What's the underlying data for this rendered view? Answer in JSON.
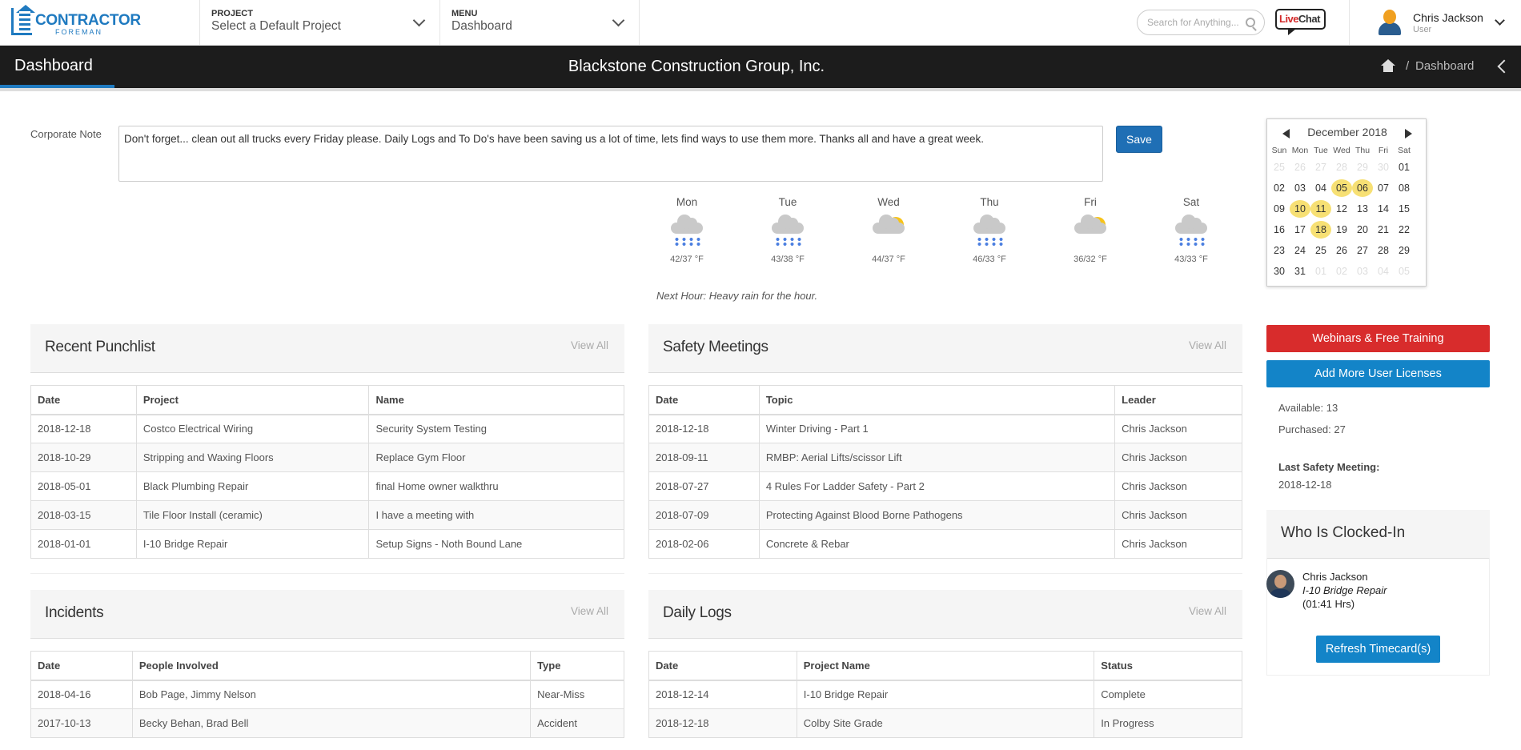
{
  "header": {
    "logo_main": "CONTRACTOR",
    "logo_sub": "FOREMAN",
    "project_label": "PROJECT",
    "project_value": "Select a Default Project",
    "menu_label": "MENU",
    "menu_value": "Dashboard",
    "search_placeholder": "Search for Anything...",
    "livechat_live": "Live",
    "livechat_chat": "Chat",
    "user_name": "Chris Jackson",
    "user_role": "User"
  },
  "titlebar": {
    "page_title": "Dashboard",
    "company": "Blackstone Construction Group, Inc.",
    "breadcrumb_sep": "/",
    "breadcrumb": "Dashboard"
  },
  "note": {
    "label": "Corporate Note",
    "text": "Don't forget... clean out all trucks every Friday please. Daily Logs and To Do's have been saving us a lot of time, lets find ways to use them more. Thanks all and have a great week.",
    "save_label": "Save"
  },
  "weather": {
    "days": [
      {
        "day": "Mon",
        "temp": "42/37 °F",
        "icon": "rain-cloud-icon"
      },
      {
        "day": "Tue",
        "temp": "43/38 °F",
        "icon": "rain-cloud-icon"
      },
      {
        "day": "Wed",
        "temp": "44/37 °F",
        "icon": "partly-sunny-icon"
      },
      {
        "day": "Thu",
        "temp": "46/33 °F",
        "icon": "rain-cloud-icon"
      },
      {
        "day": "Fri",
        "temp": "36/32 °F",
        "icon": "partly-sunny-icon"
      },
      {
        "day": "Sat",
        "temp": "43/33 °F",
        "icon": "rain-cloud-icon"
      }
    ],
    "next_hour": "Next Hour: Heavy rain for the hour."
  },
  "calendar": {
    "month": "December 2018",
    "dows": [
      "Sun",
      "Mon",
      "Tue",
      "Wed",
      "Thu",
      "Fri",
      "Sat"
    ],
    "weeks": [
      [
        "25",
        "26",
        "27",
        "28",
        "29",
        "30",
        "01"
      ],
      [
        "02",
        "03",
        "04",
        "05",
        "06",
        "07",
        "08"
      ],
      [
        "09",
        "10",
        "11",
        "12",
        "13",
        "14",
        "15"
      ],
      [
        "16",
        "17",
        "18",
        "19",
        "20",
        "21",
        "22"
      ],
      [
        "23",
        "24",
        "25",
        "26",
        "27",
        "28",
        "29"
      ],
      [
        "30",
        "31",
        "01",
        "02",
        "03",
        "04",
        "05"
      ]
    ],
    "highlighted": [
      "05",
      "06",
      "10",
      "11",
      "18"
    ],
    "highlight_color": "#f7e074"
  },
  "punchlist": {
    "title": "Recent Punchlist",
    "view_all": "View All",
    "columns": [
      "Date",
      "Project",
      "Name"
    ],
    "rows": [
      [
        "2018-12-18",
        "Costco Electrical Wiring",
        "Security System Testing"
      ],
      [
        "2018-10-29",
        "Stripping and Waxing Floors",
        "Replace Gym Floor"
      ],
      [
        "2018-05-01",
        "Black Plumbing Repair",
        "final Home owner walkthru"
      ],
      [
        "2018-03-15",
        "Tile Floor Install (ceramic)",
        "I have a meeting with"
      ],
      [
        "2018-01-01",
        "I-10 Bridge Repair",
        "Setup Signs - Noth Bound Lane"
      ]
    ]
  },
  "safety": {
    "title": "Safety Meetings",
    "view_all": "View All",
    "columns": [
      "Date",
      "Topic",
      "Leader"
    ],
    "rows": [
      [
        "2018-12-18",
        "Winter Driving - Part 1",
        "Chris Jackson"
      ],
      [
        "2018-09-11",
        "RMBP: Aerial Lifts/scissor Lift",
        "Chris Jackson"
      ],
      [
        "2018-07-27",
        "4 Rules For Ladder Safety - Part 2",
        "Chris Jackson"
      ],
      [
        "2018-07-09",
        "Protecting Against Blood Borne Pathogens",
        "Chris Jackson"
      ],
      [
        "2018-02-06",
        "Concrete & Rebar",
        "Chris Jackson"
      ]
    ]
  },
  "incidents": {
    "title": "Incidents",
    "view_all": "View All",
    "columns": [
      "Date",
      "People Involved",
      "Type"
    ],
    "rows": [
      [
        "2018-04-16",
        "Bob Page, Jimmy Nelson",
        "Near-Miss"
      ],
      [
        "2017-10-13",
        "Becky Behan, Brad Bell",
        "Accident"
      ]
    ]
  },
  "dailylogs": {
    "title": "Daily Logs",
    "view_all": "View All",
    "columns": [
      "Date",
      "Project Name",
      "Status"
    ],
    "rows": [
      [
        "2018-12-14",
        "I-10 Bridge Repair",
        "Complete"
      ],
      [
        "2018-12-18",
        "Colby Site Grade",
        "In Progress"
      ]
    ]
  },
  "sidebar": {
    "webinars_label": "Webinars & Free Training",
    "licenses_label": "Add More User Licenses",
    "available": "Available: 13",
    "purchased": "Purchased: 27",
    "last_safety_label": "Last Safety Meeting:",
    "last_safety_date": "2018-12-18",
    "clocked_title": "Who Is Clocked-In",
    "clocked_name": "Chris Jackson",
    "clocked_project": "I-10 Bridge Repair",
    "clocked_hours": "(01:41 Hrs)",
    "refresh_label": "Refresh Timecard(s)"
  },
  "colors": {
    "brand": "#1f7ac0",
    "danger": "#d82c2c",
    "primary": "#1384c8",
    "titlebar": "#1c1c1c"
  }
}
